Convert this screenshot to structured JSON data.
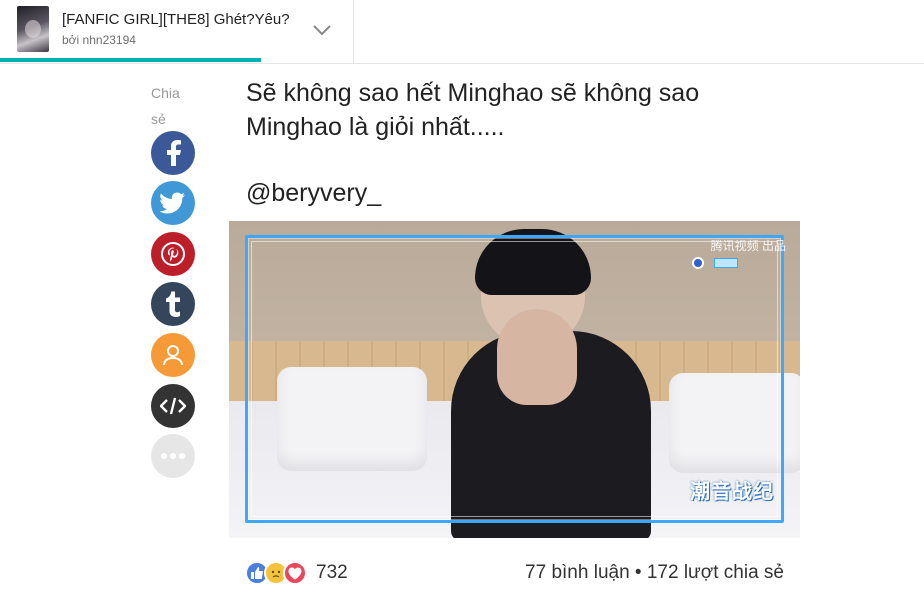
{
  "header": {
    "story_title": "[FANFIC GIRL][THE8] Ghét?Yêu?",
    "author": "bởi nhn23194",
    "progress_fraction": 0.283
  },
  "share": {
    "label": "Chia sẻ",
    "buttons": [
      {
        "name": "facebook",
        "icon": "facebook-icon",
        "color": "#3b5998"
      },
      {
        "name": "twitter",
        "icon": "twitter-icon",
        "color": "#4099d6"
      },
      {
        "name": "pinterest",
        "icon": "pinterest-icon",
        "color": "#bd1f2a"
      },
      {
        "name": "tumblr",
        "icon": "tumblr-icon",
        "color": "#35465c"
      },
      {
        "name": "profile",
        "icon": "user-icon",
        "color": "#f59a36"
      },
      {
        "name": "embed",
        "icon": "code-icon",
        "color": "#333333"
      },
      {
        "name": "more",
        "icon": "more-icon",
        "color": "#e6e6e6"
      }
    ]
  },
  "post": {
    "lines": [
      "Sẽ không sao hết Minghao sẽ không sao",
      "Minghao là giỏi nhất....."
    ],
    "handle": "@beryvery_"
  },
  "media": {
    "watermark_top": "腾讯视频 出品",
    "watermark_bottom": "潮音战纪"
  },
  "footer": {
    "reaction_count": "732",
    "comments": "77 bình luận • 172 lượt chia sẻ"
  },
  "colors": {
    "accent": "#00b2b2",
    "frame": "#3ea7ff"
  }
}
